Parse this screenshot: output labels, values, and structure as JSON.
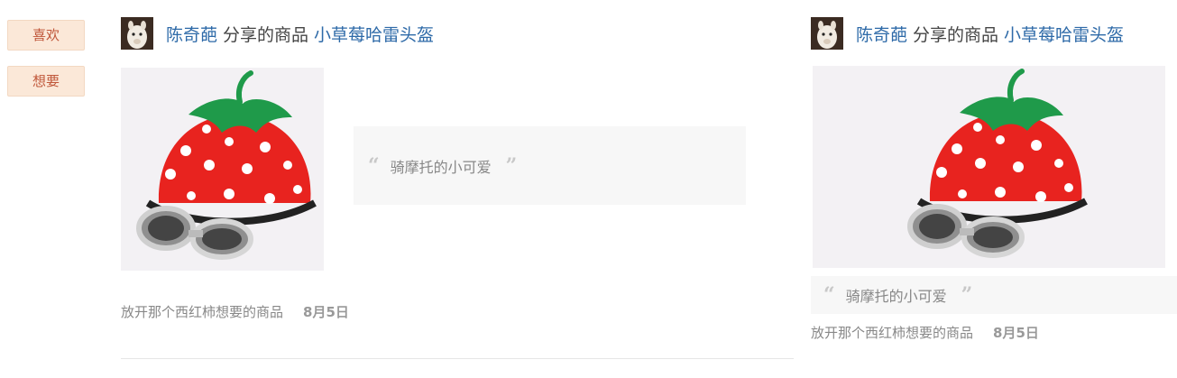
{
  "actions": {
    "like_label": "喜欢",
    "want_label": "想要"
  },
  "shares": [
    {
      "user_name": "陈奇葩",
      "shared_text": "分享的商品",
      "product_name": "小草莓哈雷头盔",
      "quote": "骑摩托的小可爱",
      "wanted_by": "放开那个西红柿想要的商品",
      "date": "8月5日"
    },
    {
      "user_name": "陈奇葩",
      "shared_text": "分享的商品",
      "product_name": "小草莓哈雷头盔",
      "quote": "骑摩托的小可爱",
      "wanted_by": "放开那个西红柿想要的商品",
      "date": "8月5日"
    }
  ],
  "colors": {
    "link": "#2e6aa8",
    "button_bg": "#fbe8d8",
    "button_text": "#c0573a",
    "helmet_red": "#e8231f",
    "leaf_green": "#1f9a4a"
  }
}
